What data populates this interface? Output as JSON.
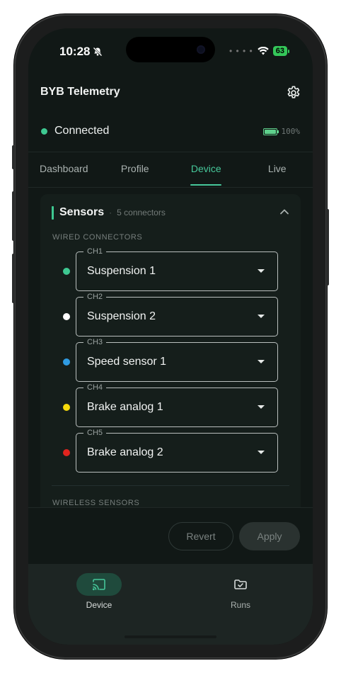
{
  "status_bar": {
    "time": "10:28",
    "battery": "63"
  },
  "app": {
    "title": "BYB Telemetry"
  },
  "connection": {
    "status": "Connected",
    "battery_pct": "100%",
    "status_color": "#3ec891"
  },
  "tabs": [
    {
      "label": "Dashboard",
      "active": false
    },
    {
      "label": "Profile",
      "active": false
    },
    {
      "label": "Device",
      "active": true
    },
    {
      "label": "Live",
      "active": false
    }
  ],
  "sensors_card": {
    "title": "Sensors",
    "subtitle": "5 connectors",
    "wired_label": "WIRED CONNECTORS",
    "wireless_label": "WIRELESS SENSORS",
    "connectors": [
      {
        "channel": "CH1",
        "value": "Suspension 1",
        "color": "#3ec891"
      },
      {
        "channel": "CH2",
        "value": "Suspension 2",
        "color": "#ffffff"
      },
      {
        "channel": "CH3",
        "value": "Speed sensor 1",
        "color": "#2f9be3"
      },
      {
        "channel": "CH4",
        "value": "Brake analog 1",
        "color": "#f5d90a"
      },
      {
        "channel": "CH5",
        "value": "Brake analog 2",
        "color": "#e0241e"
      }
    ]
  },
  "actions": {
    "revert": "Revert",
    "apply": "Apply"
  },
  "bottom_nav": [
    {
      "label": "Device",
      "icon": "cast-icon",
      "active": true
    },
    {
      "label": "Runs",
      "icon": "folder-check-icon",
      "active": false
    }
  ]
}
